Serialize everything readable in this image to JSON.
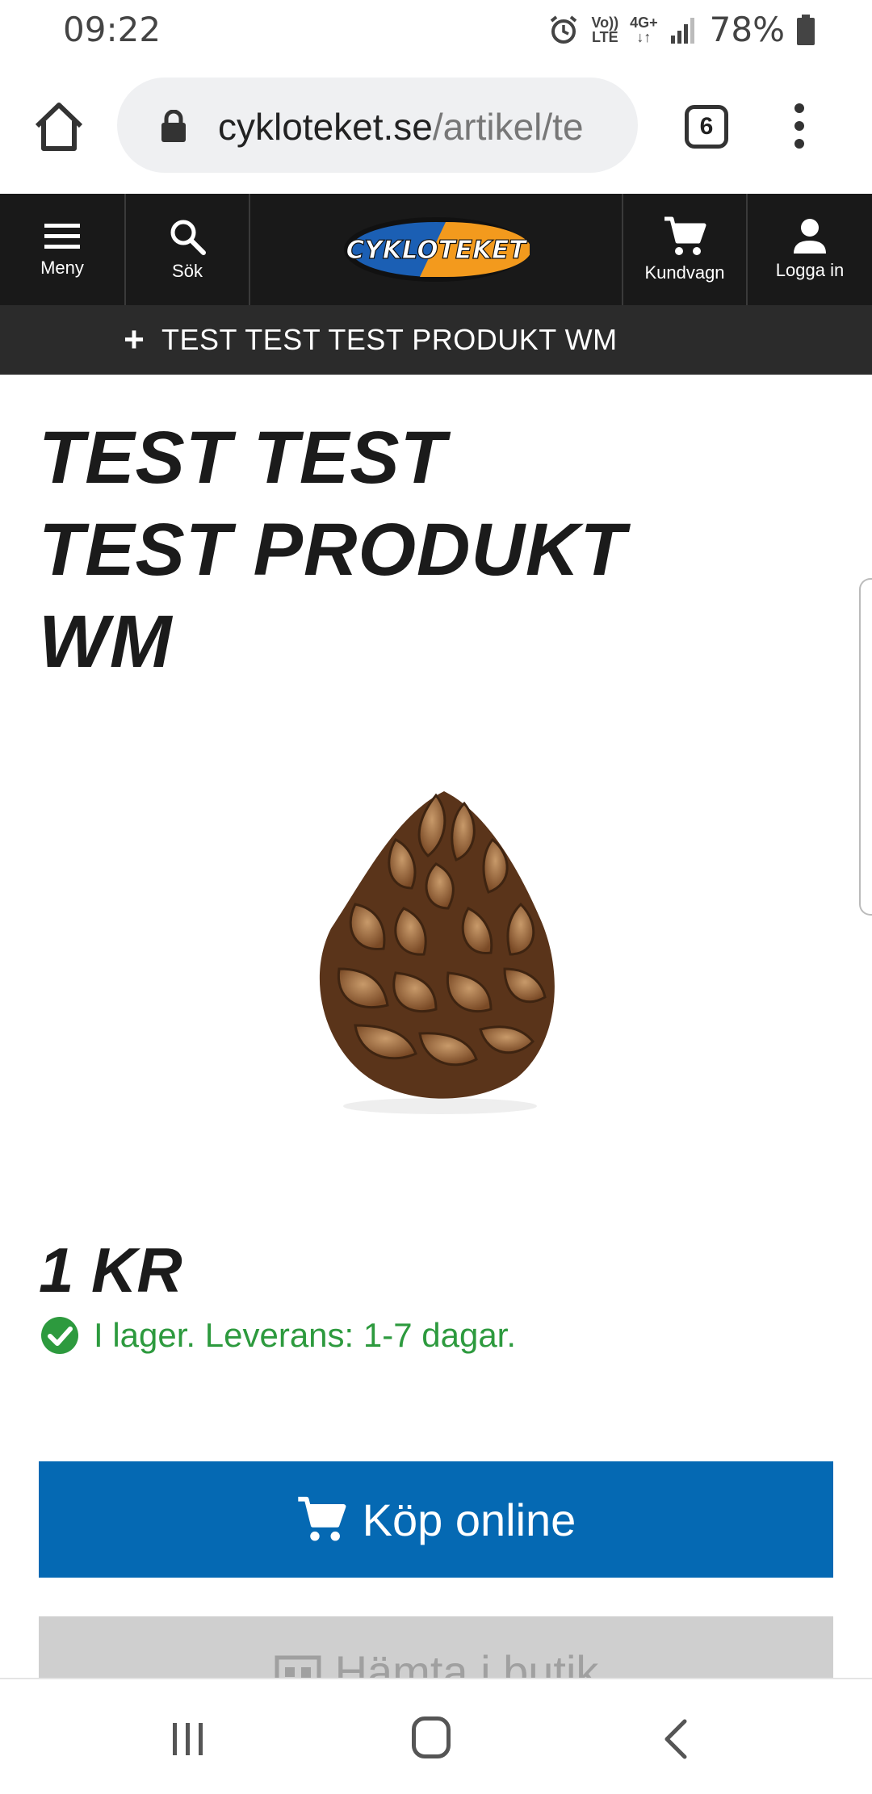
{
  "status_bar": {
    "time": "09:22",
    "network_top": "Vo))",
    "network_bottom": "LTE",
    "data_top": "4G+",
    "data_bottom": "↓↑",
    "battery": "78%"
  },
  "browser": {
    "url_domain": "cykloteket.se",
    "url_path": "/artikel/te",
    "tab_count": "6"
  },
  "site_nav": {
    "menu_label": "Meny",
    "search_label": "Sök",
    "logo_text": "CYKLOTEKET",
    "cart_label": "Kundvagn",
    "login_label": "Logga in"
  },
  "breadcrumb": {
    "icon": "+",
    "text": "TEST TEST TEST PRODUKT WM"
  },
  "product": {
    "title": "TEST TEST TEST PRODUKT WM",
    "image_icon": "pine-cone",
    "price": "1 KR",
    "stock_text": "I lager. Leverans: 1-7 dagar.",
    "buy_label": "Köp online",
    "pickup_label": "Hämta i butik"
  },
  "colors": {
    "nav_bg": "#191919",
    "breadcrumb_bg": "#2b2b2b",
    "buy_button": "#0569b3",
    "stock_green": "#2d9a3e",
    "logo_blue": "#1b5fb4",
    "logo_orange": "#f39a1d"
  }
}
